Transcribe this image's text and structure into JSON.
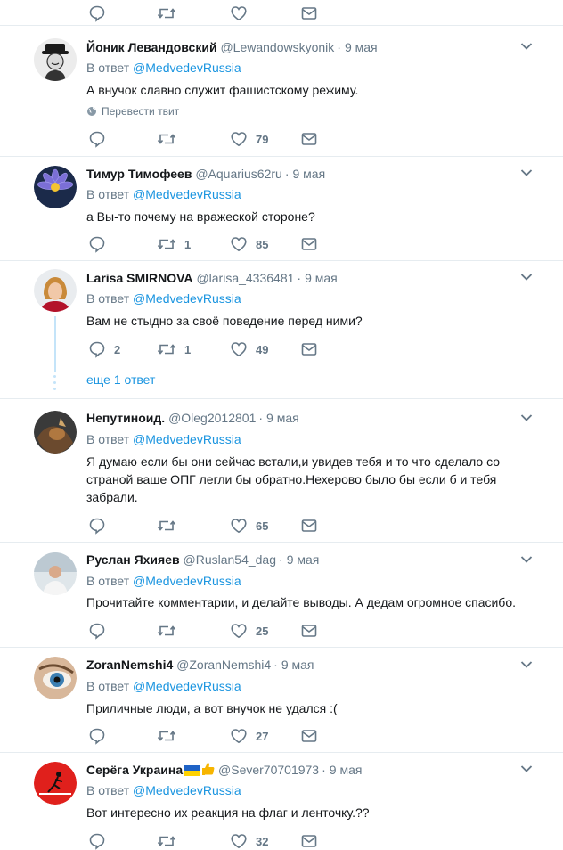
{
  "reply_prefix": "В ответ",
  "translate_label": "Перевести твит",
  "more_replies_label": "еще 1 ответ",
  "colors": {
    "link": "#1b95e0",
    "muted": "#657786",
    "border": "#e6ecf0",
    "text": "#14171a"
  },
  "tweets": [
    {
      "name": "Йоник Левандовский",
      "handle": "@Lewandowskyonik",
      "date": "9 мая",
      "mention": "@MedvedevRussia",
      "text": "А внучок славно служит фашистскому режиму.",
      "replies": "",
      "retweets": "",
      "likes": "79"
    },
    {
      "name": "Тимур Тимофеев",
      "handle": "@Aquarius62ru",
      "date": "9 мая",
      "mention": "@MedvedevRussia",
      "text": "а Вы-то почему на вражеской стороне?",
      "replies": "",
      "retweets": "1",
      "likes": "85"
    },
    {
      "name": "Larisa SMIRNOVA",
      "handle": "@larisa_4336481",
      "date": "9 мая",
      "mention": "@MedvedevRussia",
      "text": "Вам не стыдно за своё поведение перед ними?",
      "replies": "2",
      "retweets": "1",
      "likes": "49"
    },
    {
      "name": "Непутиноид.",
      "handle": "@Oleg2012801",
      "date": "9 мая",
      "mention": "@MedvedevRussia",
      "text": "Я думаю если бы они сейчас встали,и увидев тебя и то что сделало со страной ваше ОПГ легли бы обратно.Нехерово было бы если б и тебя забрали.",
      "replies": "",
      "retweets": "",
      "likes": "65"
    },
    {
      "name": "Руслан Яхияев",
      "handle": "@Ruslan54_dag",
      "date": "9 мая",
      "mention": "@MedvedevRussia",
      "text": "Прочитайте комментарии, и делайте выводы. А дедам огромное спасибо.",
      "replies": "",
      "retweets": "",
      "likes": "25"
    },
    {
      "name": "ZoranNemshi4",
      "handle": "@ZoranNemshi4",
      "date": "9 мая",
      "mention": "@MedvedevRussia",
      "text": "Приличные люди, а вот внучок не удался :(",
      "replies": "",
      "retweets": "",
      "likes": "27"
    },
    {
      "name": "Серёга Украина",
      "handle": "@Sever70701973",
      "date": "9 мая",
      "mention": "@MedvedevRussia",
      "text": "Вот интересно их реакция на флаг и ленточку.??",
      "replies": "",
      "retweets": "",
      "likes": "32"
    }
  ]
}
